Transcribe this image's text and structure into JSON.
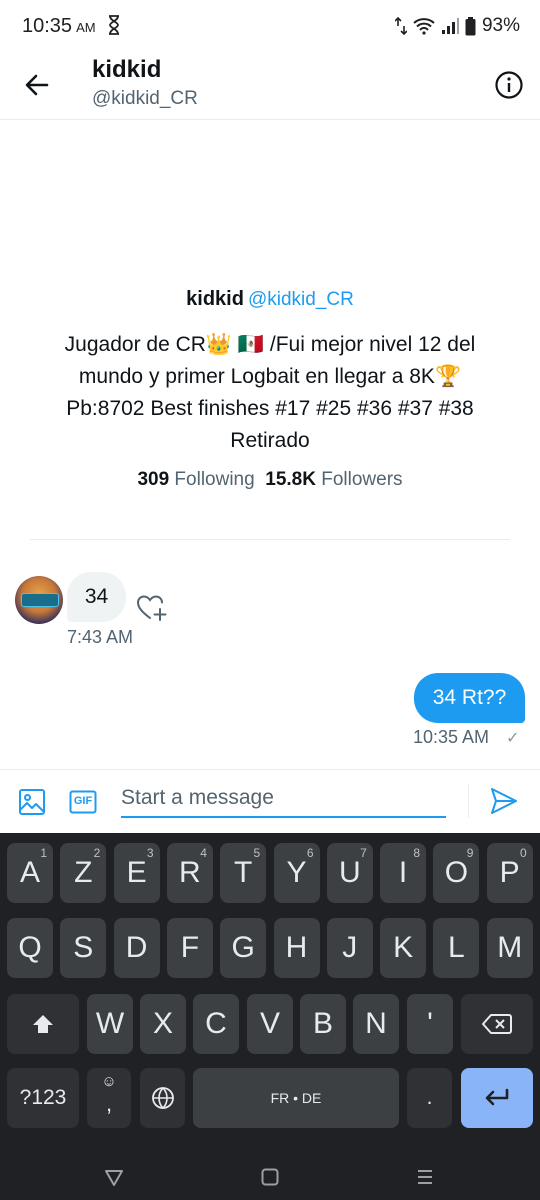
{
  "status": {
    "time": "10:35",
    "ampm": "AM",
    "battery": "93%"
  },
  "header": {
    "name": "kidkid",
    "handle": "@kidkid_CR"
  },
  "profile": {
    "name": "kidkid",
    "handle": "@kidkid_CR",
    "bio": "Jugador de CR👑 🇲🇽 /Fui mejor nivel 12 del\nmundo y primer Logbait en llegar a 8K🏆\nPb:8702 Best finishes #17 #25 #36 #37 #38\nRetirado",
    "following_count": "309",
    "following_label": "Following",
    "followers_count": "15.8K",
    "followers_label": "Followers"
  },
  "messages": [
    {
      "direction": "received",
      "text": "34",
      "time": "7:43 AM"
    },
    {
      "direction": "sent",
      "text": "34 Rt??",
      "time": "10:35 AM"
    }
  ],
  "composer": {
    "placeholder": "Start a message",
    "gif_label": "GIF"
  },
  "keyboard": {
    "row1": [
      {
        "label": "A",
        "hint": "1"
      },
      {
        "label": "Z",
        "hint": "2"
      },
      {
        "label": "E",
        "hint": "3"
      },
      {
        "label": "R",
        "hint": "4"
      },
      {
        "label": "T",
        "hint": "5"
      },
      {
        "label": "Y",
        "hint": "6"
      },
      {
        "label": "U",
        "hint": "7"
      },
      {
        "label": "I",
        "hint": "8"
      },
      {
        "label": "O",
        "hint": "9"
      },
      {
        "label": "P",
        "hint": "0"
      }
    ],
    "row2": [
      "Q",
      "S",
      "D",
      "F",
      "G",
      "H",
      "J",
      "K",
      "L",
      "M"
    ],
    "row3": [
      "W",
      "X",
      "C",
      "V",
      "B",
      "N",
      "'"
    ],
    "symbols_label": "?123",
    "comma_label": ",",
    "space_label": "FR • DE",
    "period_label": "."
  },
  "colors": {
    "accent": "#1d9bf0",
    "keyboard_bg": "#202124",
    "key_bg": "#3c4043",
    "enter_key": "#8ab4f8"
  }
}
